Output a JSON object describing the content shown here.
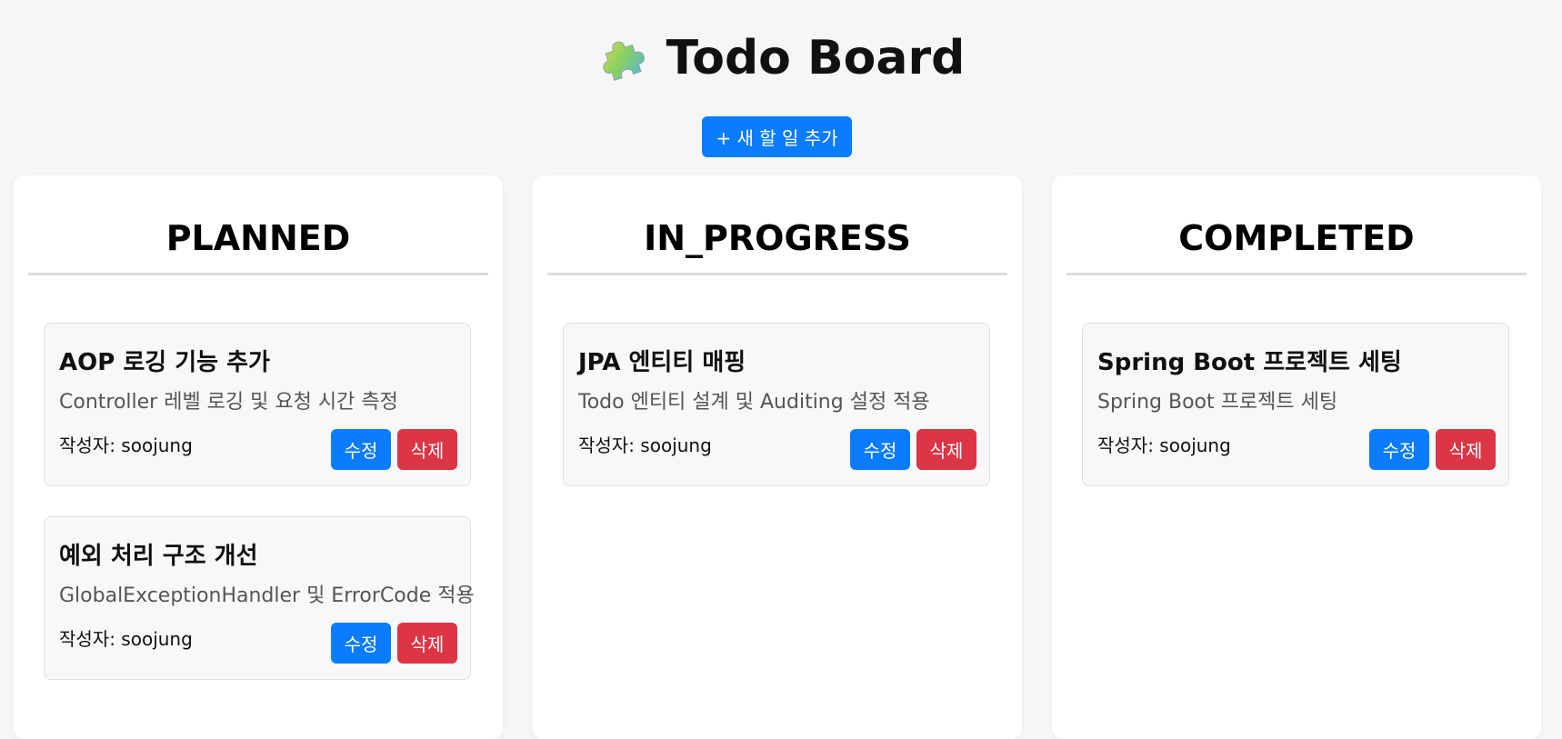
{
  "header": {
    "title": "Todo Board",
    "add_button_label": "+ 새 할 일 추가"
  },
  "columns": [
    {
      "title": "PLANNED",
      "cards": [
        {
          "title": "AOP 로깅 기능 추가",
          "description": "Controller 레벨 로깅 및 요청 시간 측정",
          "author": "작성자: soojung",
          "edit_label": "수정",
          "delete_label": "삭제"
        },
        {
          "title": "예외 처리 구조 개선",
          "description": "GlobalExceptionHandler 및 ErrorCode 적용",
          "author": "작성자: soojung",
          "edit_label": "수정",
          "delete_label": "삭제"
        }
      ]
    },
    {
      "title": "IN_PROGRESS",
      "cards": [
        {
          "title": "JPA 엔티티 매핑",
          "description": "Todo 엔티티 설계 및 Auditing 설정 적용",
          "author": "작성자: soojung",
          "edit_label": "수정",
          "delete_label": "삭제"
        }
      ]
    },
    {
      "title": "COMPLETED",
      "cards": [
        {
          "title": "Spring Boot 프로젝트 세팅",
          "description": "Spring Boot 프로젝트 세팅",
          "author": "작성자: soojung",
          "edit_label": "수정",
          "delete_label": "삭제"
        }
      ]
    }
  ],
  "colors": {
    "page_bg": "#f5f6f8",
    "primary": "#0a7cff",
    "danger": "#dc3545",
    "card_bg": "#f8f8f8"
  },
  "icons": {
    "title_icon": "puzzle-piece-icon"
  }
}
